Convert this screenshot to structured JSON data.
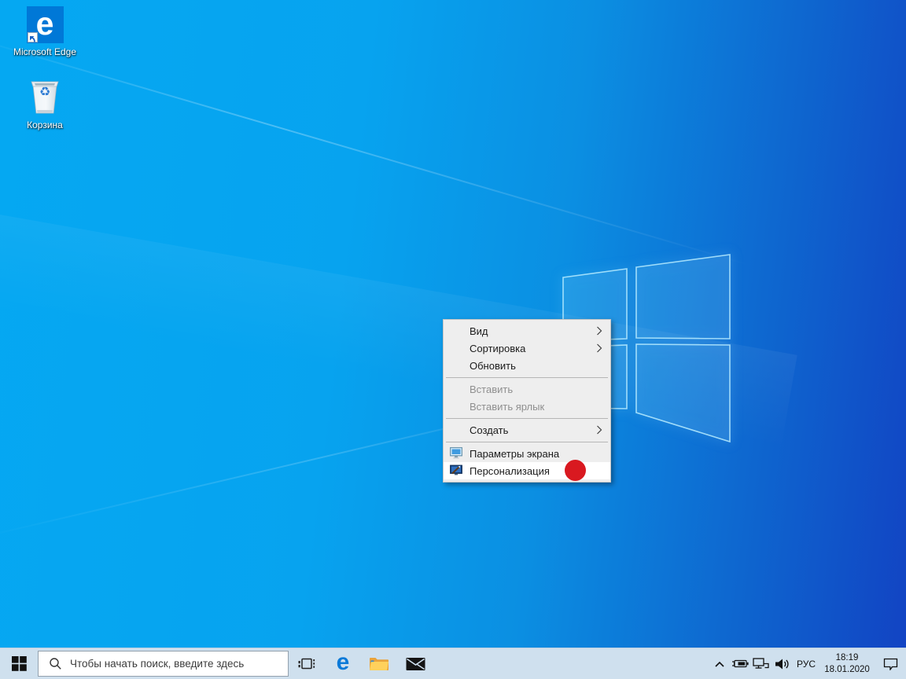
{
  "colors": {
    "accent": "#0078d7",
    "wallpaper_left": "#05a8f2",
    "wallpaper_right": "#1243c3",
    "taskbar_bg": "#cfe0ee",
    "menu_bg": "#eeeeee",
    "menu_highlight": "#ffffff",
    "marker_red": "#d91920"
  },
  "desktop": {
    "icons": [
      {
        "name": "microsoft-edge-shortcut",
        "label": "Microsoft Edge",
        "glyph": "e"
      },
      {
        "name": "recycle-bin",
        "label": "Корзина",
        "glyph": "♻"
      }
    ]
  },
  "context_menu": {
    "items": [
      {
        "label": "Вид",
        "submenu": true,
        "enabled": true
      },
      {
        "label": "Сортировка",
        "submenu": true,
        "enabled": true
      },
      {
        "label": "Обновить",
        "submenu": false,
        "enabled": true
      },
      {
        "label": "Вставить",
        "submenu": false,
        "enabled": false
      },
      {
        "label": "Вставить ярлык",
        "submenu": false,
        "enabled": false
      },
      {
        "label": "Создать",
        "submenu": true,
        "enabled": true
      },
      {
        "label": "Параметры экрана",
        "submenu": false,
        "enabled": true,
        "icon": "display-settings-icon"
      },
      {
        "label": "Персонализация",
        "submenu": false,
        "enabled": true,
        "icon": "personalization-icon",
        "highlighted": true
      }
    ]
  },
  "taskbar": {
    "search_placeholder": "Чтобы начать поиск, введите здесь",
    "tray": {
      "language": "РУС",
      "time": "18:19",
      "date": "18.01.2020"
    }
  }
}
